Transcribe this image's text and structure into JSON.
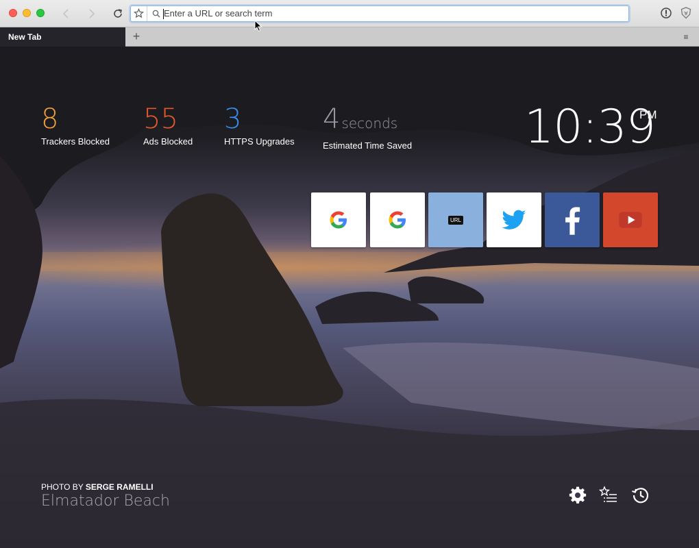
{
  "window": {
    "tab_title": "New Tab",
    "new_tab_label": "+",
    "menu_label": "≡"
  },
  "urlbar": {
    "placeholder": "Enter a URL or search term"
  },
  "stats": {
    "trackers": {
      "value": "8",
      "label": "Trackers Blocked",
      "color": "#f0a03a"
    },
    "ads": {
      "value": "55",
      "label": "Ads Blocked",
      "color": "#e25a2c"
    },
    "https": {
      "value": "3",
      "label": "HTTPS Upgrades",
      "color": "#3a8df0"
    },
    "time": {
      "value": "4",
      "unit": "seconds",
      "label": "Estimated Time Saved",
      "color": "#9a9aa6"
    }
  },
  "clock": {
    "time": "10:39",
    "ampm": "PM"
  },
  "top_sites": [
    {
      "icon": "google-icon"
    },
    {
      "icon": "google-icon"
    },
    {
      "icon": "url-icon",
      "badge": "URL"
    },
    {
      "icon": "twitter-icon"
    },
    {
      "icon": "facebook-icon"
    },
    {
      "icon": "youtube-icon"
    }
  ],
  "photo": {
    "credit_prefix": "PHOTO BY",
    "credit_name": "SERGE RAMELLI",
    "location": "Elmatador Beach"
  },
  "icons": {
    "settings": "gear-icon",
    "bookmarks": "bookmarks-icon",
    "history": "history-icon"
  }
}
